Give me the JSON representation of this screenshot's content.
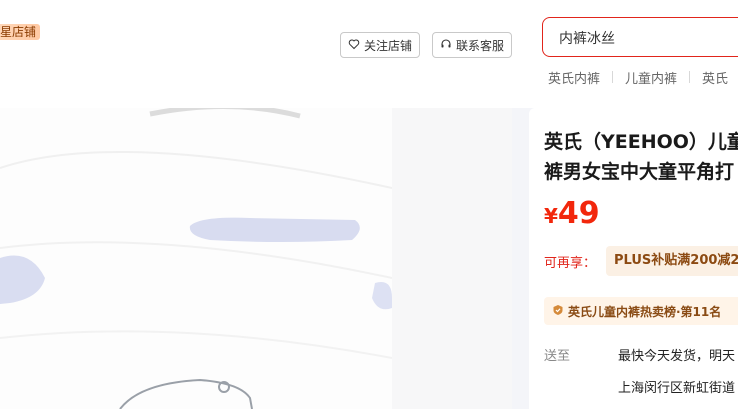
{
  "store": {
    "badge": "星店铺"
  },
  "actions": {
    "follow_label": "关注店铺",
    "service_label": "联系客服"
  },
  "search": {
    "value": "内裤冰丝"
  },
  "hot_words": [
    "英氏内裤",
    "儿童内裤",
    "英氏"
  ],
  "product": {
    "title_line1": "英氏（YEEHOO）儿童",
    "title_line2": "裤男女宝中大童平角打",
    "price_symbol": "¥",
    "price_value": "49",
    "promo_label": "可再享：",
    "promo_text": "PLUS补贴满200减2",
    "rank_text": "英氏儿童内裤热卖榜·第11名",
    "ship_label": "送至",
    "ship_text": "最快今天发货，明天",
    "ship_address": "上海闵行区新虹街道"
  },
  "colors": {
    "accent": "#e1251b",
    "price": "#f2270c",
    "promo_bg": "#fbf0e4"
  }
}
